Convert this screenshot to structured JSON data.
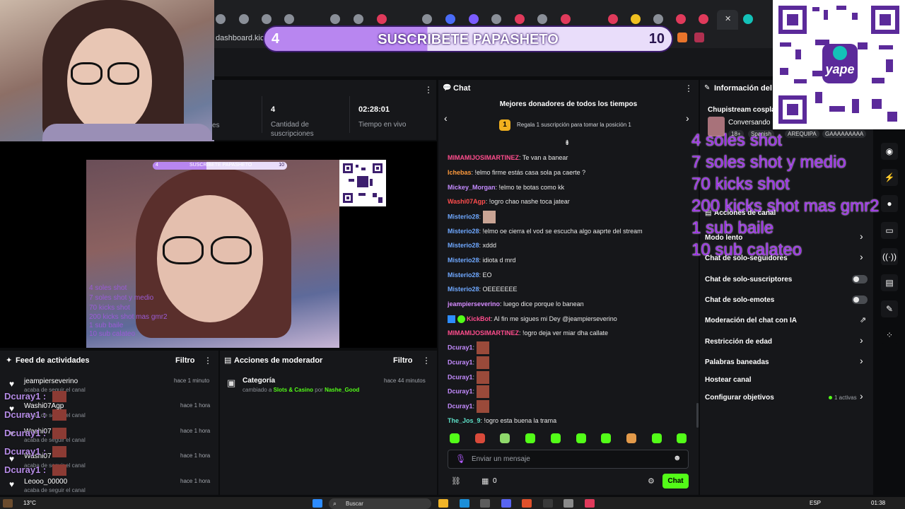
{
  "browser": {
    "address": "dashboard.kick.",
    "close_glyph": "✕"
  },
  "sub_banner": {
    "left_count": "4",
    "title": "SUSCRIBETE PAPASHETO",
    "right_count": "10"
  },
  "stats": [
    {
      "value": "4",
      "label": "Cantidad de suscripciones"
    },
    {
      "value": "02:28:01",
      "label": "Tiempo en vivo"
    }
  ],
  "stats_partial_label": "es",
  "preview": {
    "mini_banner_left": "4",
    "mini_banner_title": "SUSCRIBETE PAPASHETO",
    "mini_banner_right": "10",
    "overlay_lines": [
      "4 soles shot",
      "7 soles shot y medio",
      "70 kicks shot",
      "200 kicks shot mas gmr2",
      "1 sub baile",
      "10 sub calateo"
    ]
  },
  "feed": {
    "title": "Feed de actividades",
    "filter": "Filtro",
    "items": [
      {
        "name": "jeampierseverino",
        "sub": "acaba de seguir el canal",
        "time": "hace 1 minuto"
      },
      {
        "name": "Washi07Agp",
        "sub": "acaba de seguir el canal",
        "time": "hace 1 hora"
      },
      {
        "name": "Washi07",
        "sub": "acaba de seguir el canal",
        "time": "hace 1 hora"
      },
      {
        "name": "Washi07",
        "sub": "acaba de seguir el canal",
        "time": "hace 1 hora"
      },
      {
        "name": "Leooo_00000",
        "sub": "acaba de seguir el canal",
        "time": "hace 1 hora"
      }
    ],
    "overlay_user": "Dcuray1 :"
  },
  "mod_actions": {
    "title": "Acciones de moderador",
    "filter": "Filtro",
    "item_title": "Categoría",
    "item_prefix": "cambiado a",
    "item_category": "Slots & Casino",
    "item_by": "por",
    "item_user": "Nashe_Good",
    "item_time": "hace 44 minutos"
  },
  "chat": {
    "title": "Chat",
    "top_donors_title": "Mejores donadores de todos los tiempos",
    "top_donors_badge": "1",
    "top_donors_text": "Regala 1 suscripción para tomar la posición 1",
    "messages": [
      {
        "user": "MIMAMIJOSIMARTINEZ",
        "color": "#ff4d8d",
        "text": ": Te van a banear"
      },
      {
        "user": "Ichebas",
        "color": "#ff9a3c",
        "text": ": !elmo firme estás casa sola pa caerte ?"
      },
      {
        "user": "Mickey_Morgan",
        "color": "#c48bff",
        "text": ": !elmo te botas como kk"
      },
      {
        "user": "Washi07Agp",
        "color": "#ff4d4d",
        "text": ": !ogro chao nashe toca jatear"
      },
      {
        "user": "Misterio28",
        "color": "#6fa8ff",
        "text": ":"
      },
      {
        "user": "Misterio28",
        "color": "#6fa8ff",
        "text": ": !elmo oe cierra el vod se escucha algo aaprte del stream"
      },
      {
        "user": "Misterio28",
        "color": "#6fa8ff",
        "text": ": xddd"
      },
      {
        "user": "Misterio28",
        "color": "#6fa8ff",
        "text": ": idiota d mrd"
      },
      {
        "user": "Misterio28",
        "color": "#6fa8ff",
        "text": ": EO"
      },
      {
        "user": "Misterio28",
        "color": "#6fa8ff",
        "text": ": OEEEEEEE"
      },
      {
        "user": "jeampierseverino",
        "color": "#d58bff",
        "text": ": luego dice porque lo banean"
      },
      {
        "user": "KickBot",
        "color": "#ff4d8d",
        "text": ": Al fin me sigues mi Dey @jeampierseverino"
      },
      {
        "user": "MIMAMIJOSIMARTINEZ",
        "color": "#ff4d8d",
        "text": ": !ogro deja ver miar dha callate"
      },
      {
        "user": "Dcuray1",
        "color": "#c48bff",
        "text": ":"
      },
      {
        "user": "Dcuray1",
        "color": "#c48bff",
        "text": ":"
      },
      {
        "user": "Dcuray1",
        "color": "#c48bff",
        "text": ":"
      },
      {
        "user": "Dcuray1",
        "color": "#c48bff",
        "text": ":"
      },
      {
        "user": "Dcuray1",
        "color": "#c48bff",
        "text": ":"
      },
      {
        "user": "The_Jos_9",
        "color": "#5ee0c8",
        "text": ": !ogro esta buena la trama"
      }
    ],
    "input_placeholder": "Enviar un mensaje",
    "footer_count": "0",
    "send_label": "Chat"
  },
  "info": {
    "title": "Información del st",
    "stream_title": "Chupistream cosplay",
    "status": "Conversando",
    "tags": [
      "18+",
      "Spanish",
      "AREQUIPA",
      "GAAAAAAAAA"
    ],
    "actions_title": "Acciones de canal",
    "rows": [
      {
        "label": "Modo lento",
        "type": "chevron"
      },
      {
        "label": "Chat de solo-seguidores",
        "type": "chevron"
      },
      {
        "label": "Chat de solo-suscriptores",
        "type": "toggle"
      },
      {
        "label": "Chat de solo-emotes",
        "type": "toggle"
      },
      {
        "label": "Moderación del chat con IA",
        "type": "link"
      },
      {
        "label": "Restricción de edad",
        "type": "chevron"
      },
      {
        "label": "Palabras baneadas",
        "type": "chevron"
      },
      {
        "label": "Hostear canal",
        "type": "none"
      },
      {
        "label": "Configurar objetivos",
        "type": "chevron"
      }
    ],
    "goals_active": "1 activas"
  },
  "donation_overlay": [
    "4 soles  shot",
    "7 soles  shot  y medio",
    "70 kicks  shot",
    "200 kicks  shot mas gmr2",
    "1 sub baile",
    "10 sub calateo"
  ],
  "qr_brand": "yape",
  "taskbar": {
    "weather": "13°C",
    "search": "Buscar",
    "lang": "ESP",
    "time": "01:38"
  },
  "colors": {
    "kick_green": "#53fc18",
    "panel": "#16171a",
    "donation_purple": "#9b2fe6"
  }
}
